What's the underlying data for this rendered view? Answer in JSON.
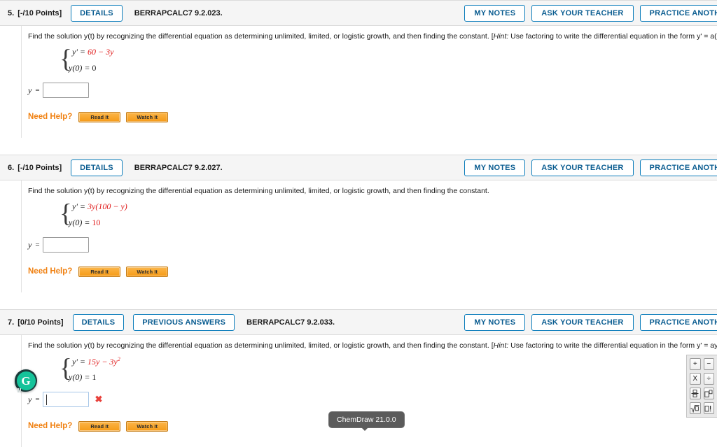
{
  "problems": [
    {
      "number": "5.",
      "points": "[-/10 Points]",
      "details_label": "DETAILS",
      "code": "BERRAPCALC7 9.2.023.",
      "question_main": "Find the solution y(t) by recognizing the differential equation as determining unlimited, limited, or logistic growth, and then finding the constant.",
      "hint_open": "[",
      "hint_word": "Hint:",
      "hint_text": " Use factoring to write the differential equation in the form y' = a(M − y).]",
      "equation_lhs": "y' =",
      "equation_rhs": "60 − 3y",
      "initial_lhs": "y(0) =",
      "initial_rhs": "0",
      "answer_label": "y",
      "answer_eq": "=",
      "answer_value": "",
      "need_help_label": "Need Help?",
      "read_it_label": "Read It",
      "watch_it_label": "Watch It",
      "my_notes_label": "MY NOTES",
      "ask_teacher_label": "ASK YOUR TEACHER",
      "practice_label": "PRACTICE ANOTHER"
    },
    {
      "number": "6.",
      "points": "[-/10 Points]",
      "details_label": "DETAILS",
      "code": "BERRAPCALC7 9.2.027.",
      "question_main": "Find the solution y(t) by recognizing the differential equation as determining unlimited, limited, or logistic growth, and then finding the constant.",
      "hint_open": "",
      "hint_word": "",
      "hint_text": "",
      "equation_lhs": "y' =",
      "equation_rhs": "3y(100 − y)",
      "initial_lhs": "y(0) =",
      "initial_rhs": "10",
      "answer_label": "y",
      "answer_eq": "=",
      "answer_value": "",
      "need_help_label": "Need Help?",
      "read_it_label": "Read It",
      "watch_it_label": "Watch It",
      "my_notes_label": "MY NOTES",
      "ask_teacher_label": "ASK YOUR TEACHER",
      "practice_label": "PRACTICE ANOTHER"
    },
    {
      "number": "7.",
      "points": "[0/10 Points]",
      "details_label": "DETAILS",
      "previous_answers_label": "PREVIOUS ANSWERS",
      "code": "BERRAPCALC7 9.2.033.",
      "question_main": "Find the solution y(t) by recognizing the differential equation as determining unlimited, limited, or logistic growth, and then finding the constant.",
      "hint_open": "[",
      "hint_word": "Hint:",
      "hint_text": " Use factoring to write the differential equation in the form y' = ay(M − y).]",
      "equation_lhs": "y' =",
      "equation_rhs": "15y − 3y",
      "equation_exp": "2",
      "initial_lhs": "y(0) =",
      "initial_rhs": "1",
      "answer_label": "y",
      "answer_eq": "=",
      "answer_value": "",
      "answer_status": "incorrect",
      "incorrect_mark": "✖",
      "need_help_label": "Need Help?",
      "read_it_label": "Read It",
      "watch_it_label": "Watch It",
      "my_notes_label": "MY NOTES",
      "ask_teacher_label": "ASK YOUR TEACHER",
      "practice_label": "PRACTICE ANOTHER"
    }
  ],
  "grammarly": {
    "letter": "G"
  },
  "tooltip": {
    "text": "ChemDraw 21.0.0"
  },
  "keypad": {
    "plus": "+",
    "minus": "−",
    "times": "X",
    "divide": "÷",
    "fraction": "fraction-icon",
    "exponent": "exponent-icon",
    "sqrt": "sqrt-icon",
    "factorial": "factorial-icon"
  },
  "colors": {
    "accent_blue": "#0c7dbb",
    "link_blue": "#0b5d91",
    "equation_red": "#e01b1b",
    "need_help_orange": "#f08010",
    "button_orange": "#f59a17",
    "incorrect_red": "#e8403a",
    "grammarly_green": "#15c39a",
    "header_bg": "#f5f5f5"
  }
}
